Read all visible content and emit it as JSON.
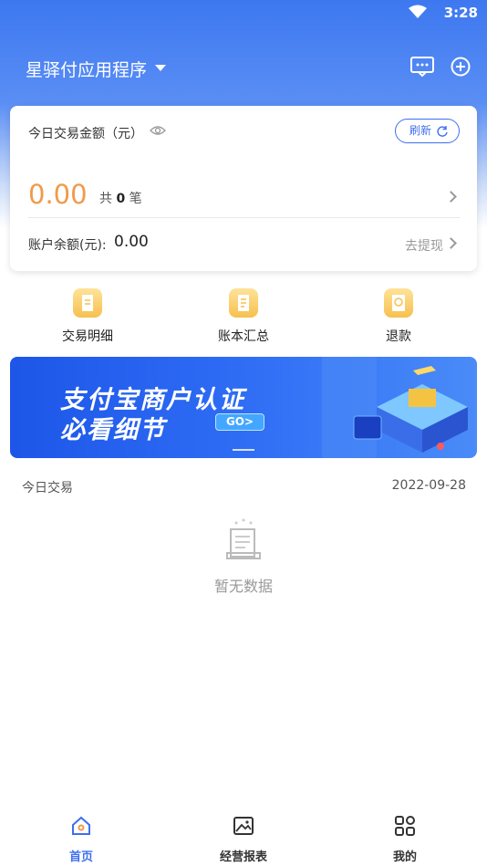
{
  "status_bar": {
    "time": "3:28"
  },
  "header": {
    "title": "星驿付应用程序"
  },
  "card": {
    "label": "今日交易金额（元）",
    "refresh": "刷新",
    "amount": "0.00",
    "count_prefix": "共",
    "count": "0",
    "count_suffix": "笔",
    "balance_label": "账户余额(元):",
    "balance_value": "0.00",
    "withdraw": "去提现"
  },
  "shortcuts": [
    {
      "label": "交易明细",
      "icon": "transaction-detail-icon"
    },
    {
      "label": "账本汇总",
      "icon": "ledger-summary-icon"
    },
    {
      "label": "退款",
      "icon": "refund-icon"
    }
  ],
  "banner": {
    "line1": "支付宝商户认证",
    "line2": "必看细节",
    "button": "GO>"
  },
  "today": {
    "label": "今日交易",
    "date": "2022-09-28"
  },
  "empty": {
    "text": "暂无数据"
  },
  "tabs": [
    {
      "label": "首页",
      "icon": "home-icon",
      "active": true
    },
    {
      "label": "经营报表",
      "icon": "image-report-icon",
      "active": false
    },
    {
      "label": "我的",
      "icon": "grid-profile-icon",
      "active": false
    }
  ],
  "colors": {
    "accent": "#3d6ff0",
    "amount": "#f09a4c",
    "header": "#3d78f0"
  }
}
